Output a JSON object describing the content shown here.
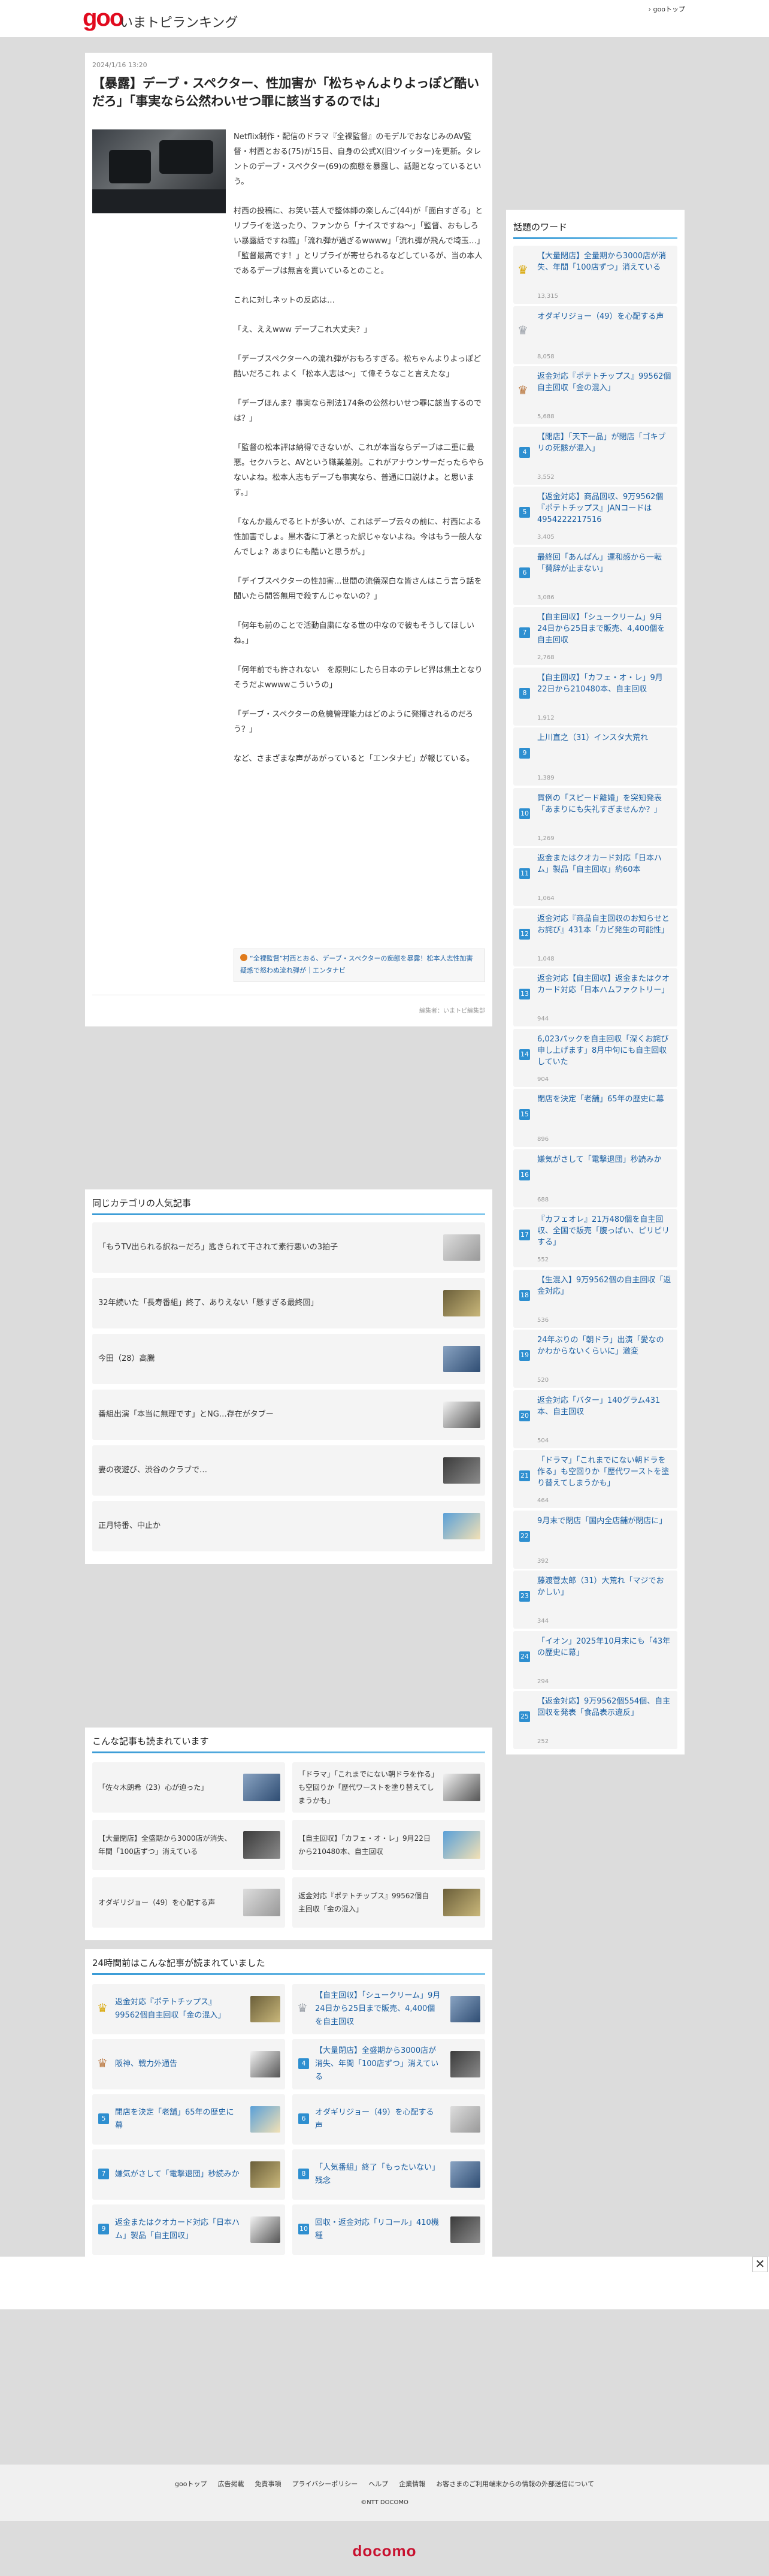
{
  "header": {
    "logo": "goo",
    "site_name": "いまトピランキング",
    "top_link": "gooトップ"
  },
  "article": {
    "date": "2024/1/16 13:20",
    "title": "【暴露】デーブ・スペクター、性加害か「松ちゃんよりよっぽど酷いだろ」「事実なら公然わいせつ罪に該当するのでは」",
    "paragraphs": [
      "Netflix制作・配信のドラマ『全裸監督』のモデルでおなじみのAV監督・村西とおる(75)が15日、自身の公式X(旧ツイッター)を更新。タレントのデーブ・スペクター(69)の痴態を暴露し、話題となっているという。",
      "村西の投稿に、お笑い芸人で整体師の楽しんご(44)が「面白すぎる」とリプライを送ったり、ファンから「ナイスですね～」「監督、おもしろい暴露話ですね臨」「流れ弾が過ぎるwwww」「流れ弾が飛んで埼玉…」「監督最高です！」とリプライが寄せられるなどしているが、当の本人であるデーブは無言を貫いているとのこと。",
      "これに対しネットの反応は…",
      "「え、ええwww デーブこれ大丈夫？」",
      "「デーブスペクターへの流れ弾がおもろすぎる。松ちゃんよりよっぽど酷いだろこれ よく「松本人志は～」て偉そうなこと言えたな」",
      "「デーブほんま？事実なら刑法174条の公然わいせつ罪に該当するのでは？」",
      "「監督の松本評は納得できないが、これが本当ならデーブは二重に最悪。セクハラと、AVという職業差別。これがアナウンサーだったらやらないよね。松本人志もデーブも事実なら、普通に口説けよ。と思います。」",
      "「なんか最んでるヒトが多いが、これはデーブ云々の前に、村西による性加害でしょ。黒木香に丁承とった訳じゃないよね。今はもう一般人なんでしょ？あまりにも酷いと思うが。」",
      "「デイブスペクターの性加害…世間の流儀深白な皆さんはこう言う話を聞いたら問答無用で殺すんじゃないの？」",
      "「何年も前のことで活動自粛になる世の中なので彼もそうしてほしいね。」",
      "「何年前でも許されない　を原則にしたら日本のテレビ界は焦土となりそうだよwwwwこういうの」",
      "「デーブ・スペクターの危機管理能力はどのように発揮されるのだろう？」",
      "など、さまざまな声があがっていると「エンタナビ」が報じている。"
    ],
    "source_link": "“全裸監督”村西とおる、デーブ・スペクターの痴態を暴露！松本人志性加害疑惑で怒わぬ流れ弾が｜エンタナビ",
    "credit": "編集者：いまトピ編集部"
  },
  "same_category": {
    "heading": "同じカテゴリの人気記事",
    "items": [
      "「もうTV出られる訳ねーだろ」匙きられて干されて素行悪いの3拍子",
      "32年続いた「長寿番組」終了、ありえない「懸すぎる最終回」",
      "今田（28）高騰",
      "番組出演「本当に無理です」とNG…存在がタブー",
      "妻の夜遊び、渋谷のクラブで…",
      "正月特番、中止か"
    ]
  },
  "ranking": {
    "heading": "話題のワード",
    "items": [
      {
        "rank": "1",
        "title": "【大量閉店】全量期から3000店が消失、年間「100店ずつ」消えている",
        "count": "13,315"
      },
      {
        "rank": "2",
        "title": "オダギリジョー（49）を心配する声",
        "count": "8,058"
      },
      {
        "rank": "3",
        "title": "返金対応『ポテトチップス』99562個自主回収「金の混入」",
        "count": "5,688"
      },
      {
        "rank": "4",
        "title": "【閉店】「天下一品」が閉店「ゴキブリの死骸が混入」",
        "count": "3,552"
      },
      {
        "rank": "5",
        "title": "【返金対応】商品回収、9万9562個『ポテトチップス』JANコードは4954222217516",
        "count": "3,405"
      },
      {
        "rank": "6",
        "title": "最終回「あんぱん」運和感から一転「賛辞が止まない」",
        "count": "3,086"
      },
      {
        "rank": "7",
        "title": "【自主回収】「シュークリーム」9月24日から25日まで販売、4,400個を自主回収",
        "count": "2,768"
      },
      {
        "rank": "8",
        "title": "【自主回収】「カフェ・オ・レ」9月22日から210480本、自主回収",
        "count": "1,912"
      },
      {
        "rank": "9",
        "title": "上川直之（31）インスタ大荒れ",
        "count": "1,389"
      },
      {
        "rank": "10",
        "title": "質例の「スピード離婚」を突知発表「あまりにも失礼すぎませんか？」",
        "count": "1,269"
      },
      {
        "rank": "11",
        "title": "返金またはクオカード対応「日本ハム」製品「自主回収」約60本",
        "count": "1,064"
      },
      {
        "rank": "12",
        "title": "返金対応『商品自主回収のお知らせとお詫び』431本「カビ発生の可能性」",
        "count": "1,048"
      },
      {
        "rank": "13",
        "title": "返金対応【自主回収】返金またはクオカード対応「日本ハムファクトリー」",
        "count": "944"
      },
      {
        "rank": "14",
        "title": "6,023パックを自主回収「深くお詫び申し上げます」8月中旬にも自主回収していた",
        "count": "904"
      },
      {
        "rank": "15",
        "title": "閉店を決定「老舗」65年の歴史に幕",
        "count": "896"
      },
      {
        "rank": "16",
        "title": "嫌気がさして「電撃退団」秒読みか",
        "count": "688"
      },
      {
        "rank": "17",
        "title": "『カフェオレ』21万480個を自主回収、全国で販売「腹っぱい、ピリピリする」",
        "count": "552"
      },
      {
        "rank": "18",
        "title": "【生混入】9万9562個の自主回収「返金対応」",
        "count": "536"
      },
      {
        "rank": "19",
        "title": "24年ぶりの「朝ドラ」出演「愛なのかわからないくらいに」激変",
        "count": "520"
      },
      {
        "rank": "20",
        "title": "返金対応「バター」140グラム431本、自主回収",
        "count": "504"
      },
      {
        "rank": "21",
        "title": "「ドラマ」「これまでにない朝ドラを作る」も空回りか「歴代ワーストを塗り替えてしまうかも」",
        "count": "464"
      },
      {
        "rank": "22",
        "title": "9月末で閉店「国内全店舗が閉店に」",
        "count": "392"
      },
      {
        "rank": "23",
        "title": "藤渡菅太郎（31）大荒れ「マジでおかしい」",
        "count": "344"
      },
      {
        "rank": "24",
        "title": "「イオン」2025年10月末にも「43年の歴史に幕」",
        "count": "294"
      },
      {
        "rank": "25",
        "title": "【返金対応】9万9562個554個、自主回収を発表「食品表示違反」",
        "count": "252"
      }
    ]
  },
  "also_read": {
    "heading": "こんな記事も読まれています",
    "items": [
      "「佐々木朗希（23）心が迫った」",
      "「ドラマ」「これまでにない朝ドラを作る」も空回りか「歴代ワーストを塗り替えてしまうかも」",
      "【大量閉店】全盛期から3000店が消失、年間「100店ずつ」消えている",
      "【自主回収】「カフェ・オ・レ」9月22日から210480本、自主回収",
      "オダギリジョー（49）を心配する声",
      "返金対応『ポテトチップス』99562個自主回収「金の混入」"
    ]
  },
  "read_24h": {
    "heading": "24時間前はこんな記事が読まれていました",
    "items": [
      {
        "rank": "1",
        "title": "返金対応『ポテトチップス』99562個自主回収「金の混入」"
      },
      {
        "rank": "2",
        "title": "【自主回収】「シュークリーム」9月24日から25日まで販売、4,400個を自主回収"
      },
      {
        "rank": "3",
        "title": "阪神、戦力外通告"
      },
      {
        "rank": "4",
        "title": "【大量閉店】全盛期から3000店が消失、年間「100店ずつ」消えている"
      },
      {
        "rank": "5",
        "title": "閉店を決定「老舗」65年の歴史に幕"
      },
      {
        "rank": "6",
        "title": "オダギリジョー（49）を心配する声"
      },
      {
        "rank": "7",
        "title": "嫌気がさして「電撃退団」秒読みか"
      },
      {
        "rank": "8",
        "title": "「人気番組」終了「もったいない」残念"
      },
      {
        "rank": "9",
        "title": "返金またはクオカード対応「日本ハム」製品「自主回収」"
      },
      {
        "rank": "10",
        "title": "回収・返金対応「リコール」410機種"
      }
    ]
  },
  "overlay": {
    "close": "✕"
  },
  "footer": {
    "links": [
      "gooトップ",
      "広告掲載",
      "免責事項",
      "プライバシーポリシー",
      "ヘルプ",
      "企業情報",
      "お客さまのご利用端末からの情報の外部送信について"
    ],
    "copyright": "©NTT DOCOMO",
    "brand": "docomo"
  },
  "colors": {
    "accent": "#e10a1e",
    "link": "#1a5fa3",
    "badge": "#2e8fd0",
    "brand_docomo": "#c8102e"
  }
}
